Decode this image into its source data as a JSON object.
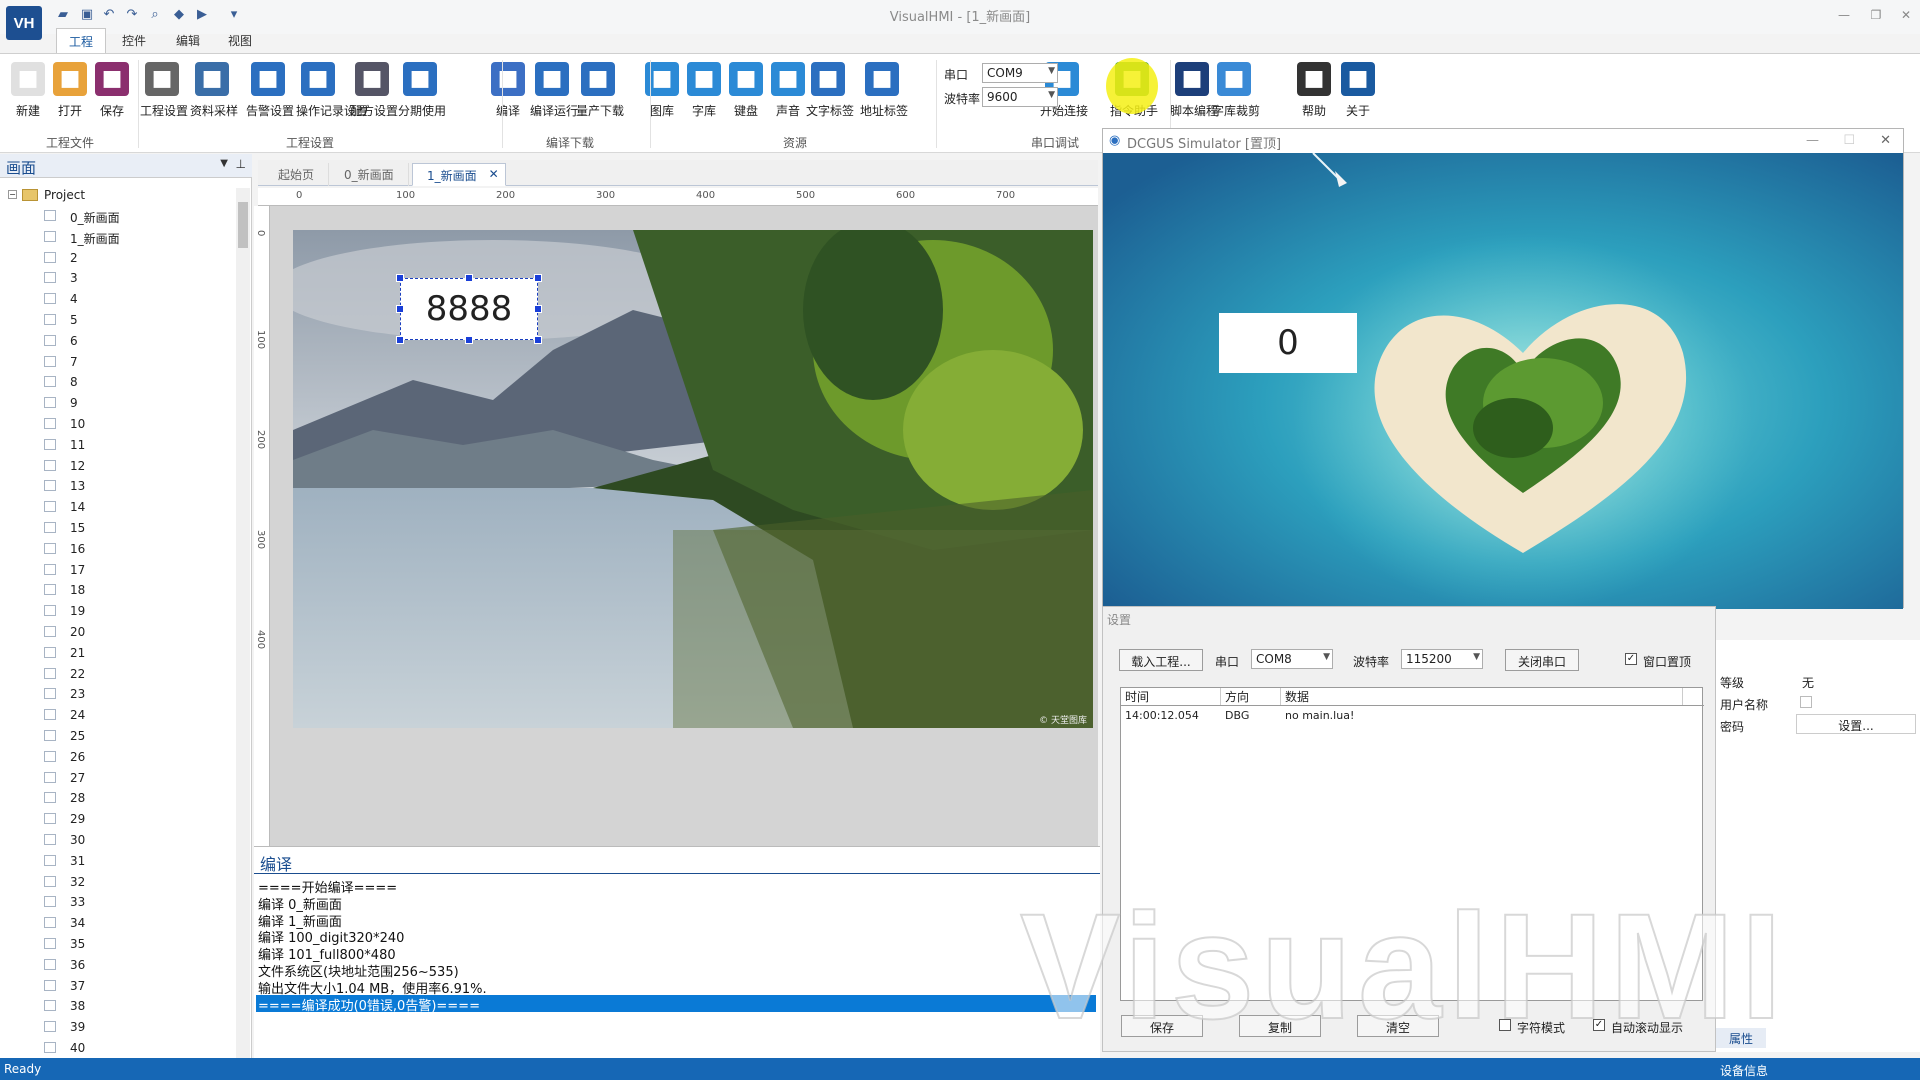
{
  "app": {
    "logo": "VH",
    "title": "VisualHMI - [1_新画面]"
  },
  "ribbon_tabs": [
    "工程",
    "控件",
    "编辑",
    "视图"
  ],
  "ribbon": {
    "buttons": [
      {
        "label": "新建",
        "icon": "new-file-icon",
        "color": "#e0e0e0"
      },
      {
        "label": "打开",
        "icon": "open-folder-icon",
        "color": "#e8a23a"
      },
      {
        "label": "保存",
        "icon": "save-icon",
        "color": "#8b2f6e"
      },
      {
        "label": "工程设置",
        "icon": "gear-icon",
        "color": "#666"
      },
      {
        "label": "资料采样",
        "icon": "sampling-icon",
        "color": "#3a6ea8"
      },
      {
        "label": "告警设置",
        "icon": "alarm-icon",
        "color": "#2b6fc0"
      },
      {
        "label": "操作记录设置",
        "icon": "log-icon",
        "color": "#2b6fc0"
      },
      {
        "label": "配方设置",
        "icon": "recipe-icon",
        "color": "#556"
      },
      {
        "label": "分期使用",
        "icon": "calendar-icon",
        "color": "#2b6fc0"
      },
      {
        "label": "编译",
        "icon": "compile-icon",
        "color": "#3c6fc4"
      },
      {
        "label": "编译运行",
        "icon": "compile-run-icon",
        "color": "#2b6fc0"
      },
      {
        "label": "量产下载",
        "icon": "download-icon",
        "color": "#2b6fc0"
      },
      {
        "label": "图库",
        "icon": "image-icon",
        "color": "#2b8ad6"
      },
      {
        "label": "字库",
        "icon": "font-icon",
        "color": "#2b8ad6"
      },
      {
        "label": "键盘",
        "icon": "keyboard-icon",
        "color": "#2b8ad6"
      },
      {
        "label": "声音",
        "icon": "sound-icon",
        "color": "#2b8ad6"
      },
      {
        "label": "文字标签",
        "icon": "tag-icon",
        "color": "#2b6fc0"
      },
      {
        "label": "地址标签",
        "icon": "address-tag-icon",
        "color": "#2b6fc0"
      },
      {
        "label": "开始连接",
        "icon": "connect-icon",
        "color": "#2b8ad6"
      },
      {
        "label": "指令助手",
        "icon": "command-helper-icon",
        "color": "#3a9a3a"
      },
      {
        "label": "脚本编程",
        "icon": "lua-icon",
        "color": "#1d3f7a"
      },
      {
        "label": "字库裁剪",
        "icon": "font-crop-icon",
        "color": "#3a8ad6"
      },
      {
        "label": "帮助",
        "icon": "help-icon",
        "color": "#333"
      },
      {
        "label": "关于",
        "icon": "info-icon",
        "color": "#1a5aa0"
      }
    ],
    "groups": [
      "工程文件",
      "工程设置",
      "编译下载",
      "资源",
      "串口调试"
    ],
    "serial": {
      "port_label": "串口",
      "port_value": "COM9",
      "baud_label": "波特率",
      "baud_value": "9600"
    }
  },
  "left_panel": {
    "title": "画面",
    "root": "Project",
    "pages": [
      "0_新画面",
      "1_新画面",
      "2",
      "3",
      "4",
      "5",
      "6",
      "7",
      "8",
      "9",
      "10",
      "11",
      "12",
      "13",
      "14",
      "15",
      "16",
      "17",
      "18",
      "19",
      "20",
      "21",
      "22",
      "23",
      "24",
      "25",
      "26",
      "27",
      "28",
      "29",
      "30",
      "31",
      "32",
      "33",
      "34",
      "35",
      "36",
      "37",
      "38",
      "39",
      "40"
    ]
  },
  "doc_tabs": [
    "起始页",
    "0_新画面",
    "1_新画面"
  ],
  "ruler_h": [
    "0",
    "100",
    "200",
    "300",
    "400",
    "500",
    "600",
    "700"
  ],
  "ruler_v": [
    "0",
    "100",
    "200",
    "300",
    "400"
  ],
  "editor": {
    "digit_text": "8888",
    "watermark_small": "© 天堂图库"
  },
  "output": {
    "title": "编译",
    "lines": [
      "====开始编译====",
      "编译 0_新画面",
      "编译 1_新画面",
      "编译 100_digit320*240",
      "编译 101_full800*480",
      "文件系统区(块地址范围256~535)",
      "输出文件大小1.04 MB，使用率6.91%.",
      "====编译成功(0错误,0告警)===="
    ]
  },
  "simulator": {
    "title": "DCGUS Simulator [置顶]",
    "value": "0"
  },
  "settings": {
    "title": "设置",
    "load_btn": "载入工程...",
    "port_label": "串口",
    "port_value": "COM8",
    "baud_label": "波特率",
    "baud_value": "115200",
    "close_port_btn": "关闭串口",
    "topmost_label": "窗口置顶",
    "topmost_checked": true,
    "log_headers": [
      "时间",
      "方向",
      "数据"
    ],
    "log_rows": [
      {
        "time": "14:00:12.054",
        "dir": "DBG",
        "data": "no main.lua!"
      }
    ],
    "save_btn": "保存",
    "copy_btn": "复制",
    "clear_btn": "清空",
    "char_mode_label": "字符模式",
    "char_mode_checked": false,
    "autoscroll_label": "自动滚动显示",
    "autoscroll_checked": true
  },
  "props": {
    "rows": [
      {
        "k": "等级",
        "v": "无"
      },
      {
        "k": "用户名称",
        "v": ""
      },
      {
        "k": "密码",
        "v": "设置..."
      }
    ],
    "tab": "属性"
  },
  "status": {
    "left": "Ready",
    "right": "设备信息"
  },
  "watermark": "VisualHMI"
}
